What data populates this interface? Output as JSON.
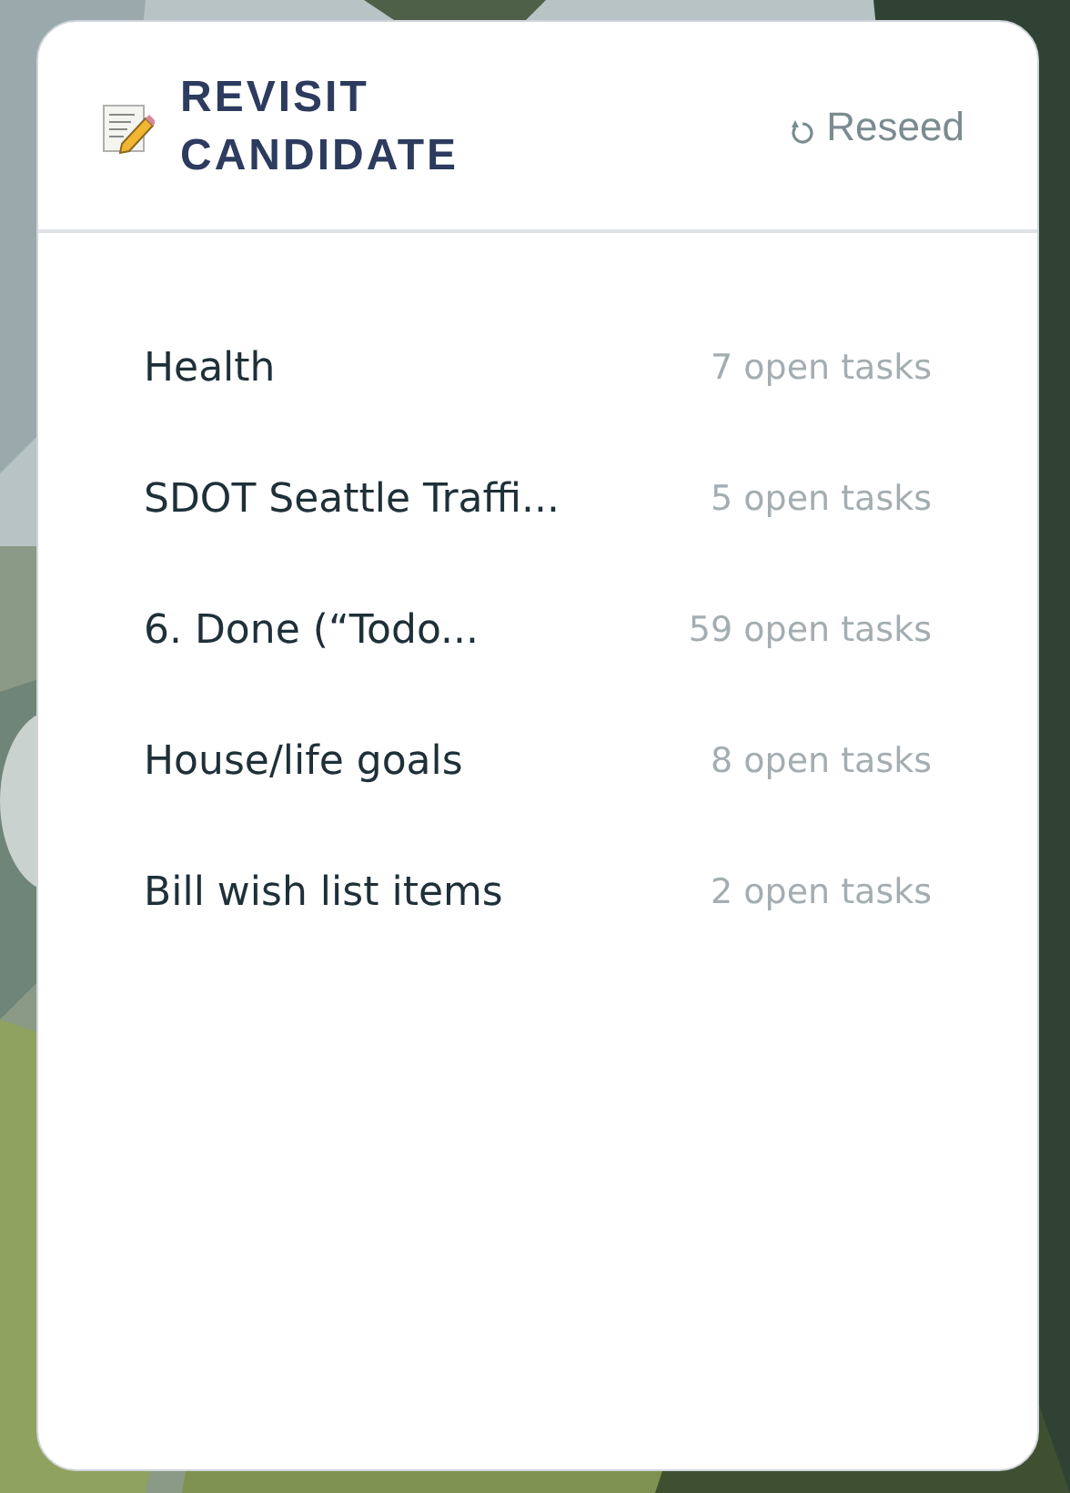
{
  "widget": {
    "title_lines": [
      "REVISIT",
      "CANDIDATE"
    ],
    "action": "Reseed"
  },
  "projects": [
    {
      "name": "Health",
      "count": "7 open tasks"
    },
    {
      "name": "SDOT Seattle Traffi...",
      "count": "5 open tasks"
    },
    {
      "name": "6. Done (“Todo...",
      "count": "59 open tasks"
    },
    {
      "name": "House/life goals",
      "count": "8 open tasks"
    },
    {
      "name": "Bill wish list items",
      "count": "2 open tasks"
    }
  ]
}
